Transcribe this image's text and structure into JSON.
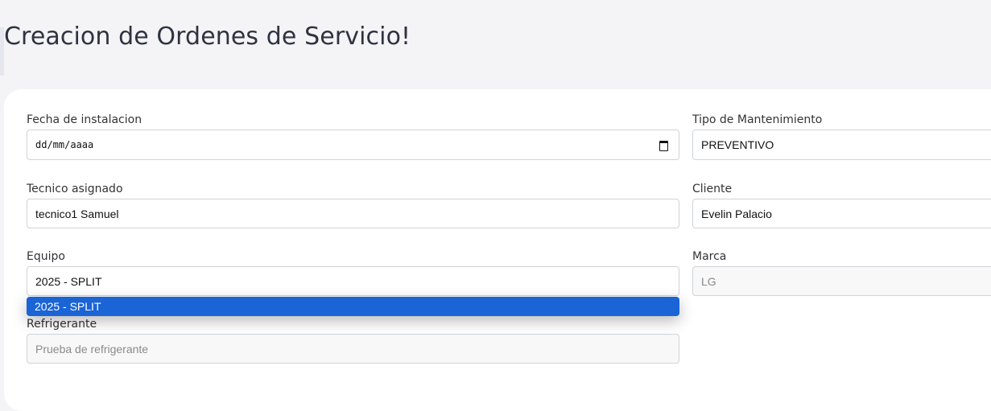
{
  "page": {
    "title": "Creacion de Ordenes de Servicio!"
  },
  "form": {
    "fecha": {
      "label": "Fecha de instalacion",
      "placeholder": "dd/mm/aaaa"
    },
    "tipo": {
      "label": "Tipo de Mantenimiento",
      "value": "PREVENTIVO"
    },
    "tecnico": {
      "label": "Tecnico asignado",
      "value": "tecnico1 Samuel"
    },
    "cliente": {
      "label": "Cliente",
      "value": "Evelin Palacio"
    },
    "equipo": {
      "label": "Equipo",
      "value": "2025 - SPLIT",
      "options": [
        "2025 - SPLIT"
      ]
    },
    "marca": {
      "label": "Marca",
      "value": "LG"
    },
    "refrigerante": {
      "label": "Refrigerante",
      "value": "Prueba de refrigerante"
    }
  },
  "icons": {
    "date_picker": "calendar-icon"
  }
}
